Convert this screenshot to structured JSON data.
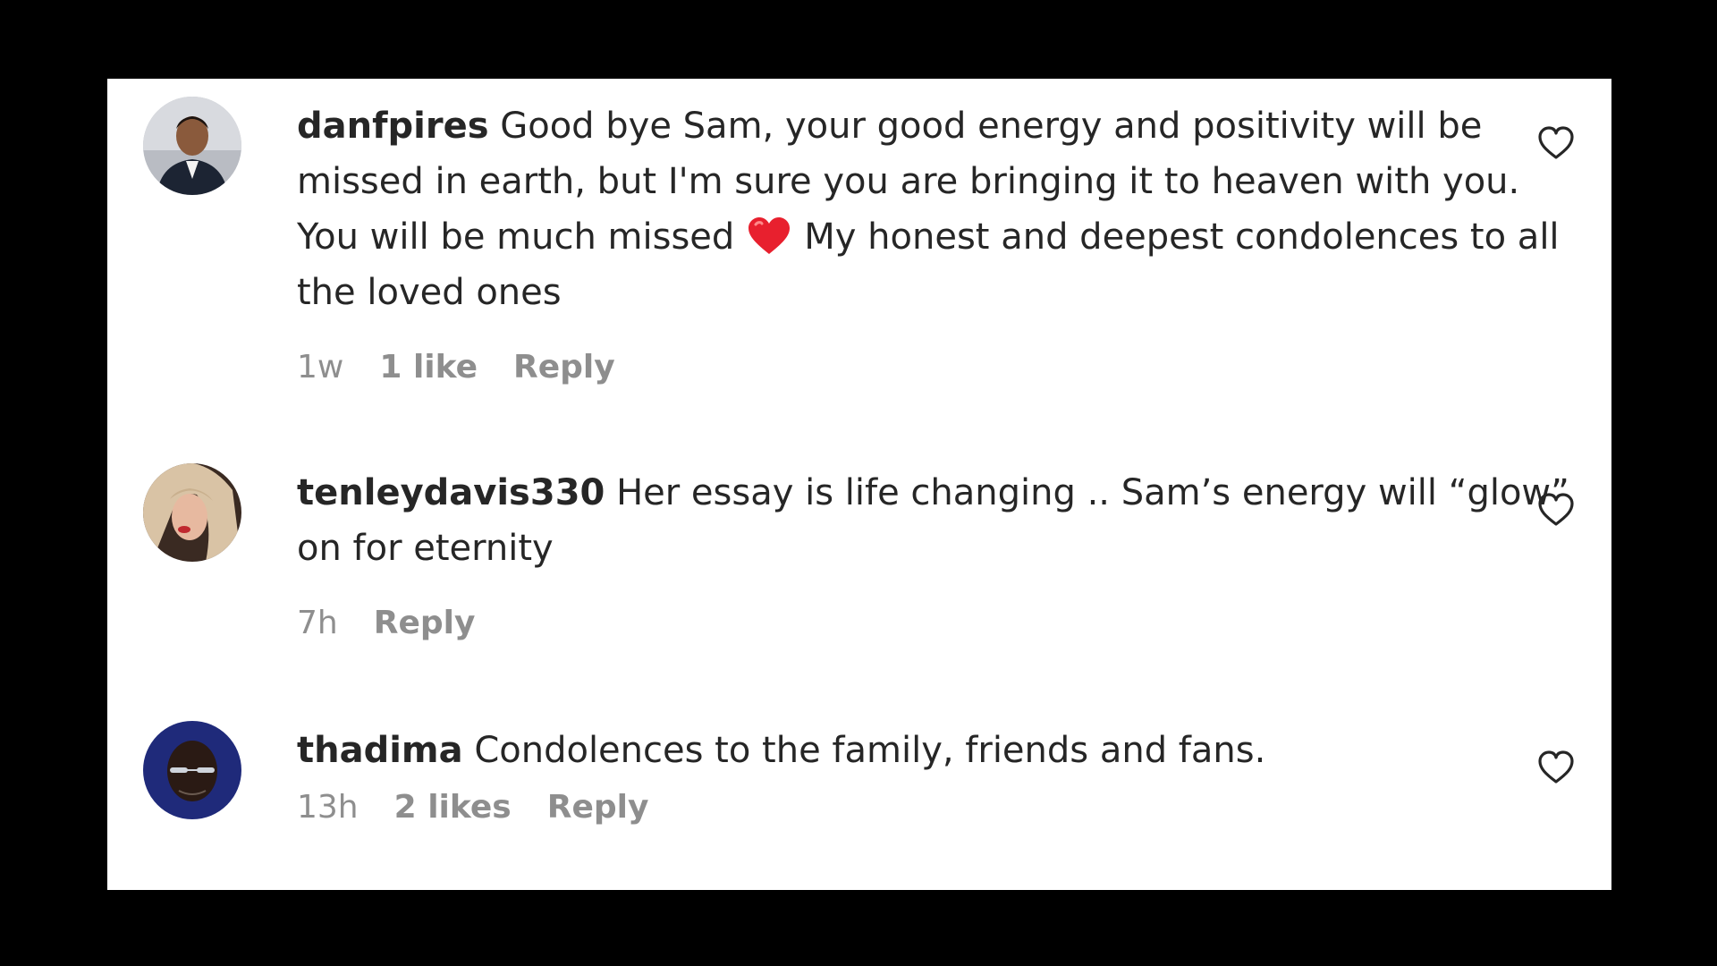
{
  "comments": [
    {
      "username": "danfpires",
      "text_before": "Good bye Sam, your good energy and positivity will be missed in earth, but I'm sure you are bringing it to heaven with you. You will be much missed",
      "emoji": "red-heart",
      "text_after": "My honest and deepest condolences to all the loved ones",
      "time": "1w",
      "likes": "1 like",
      "reply": "Reply"
    },
    {
      "username": "tenleydavis330",
      "text": "Her essay is life changing .. Sam’s energy will “glow” on for eternity",
      "time": "7h",
      "reply": "Reply"
    },
    {
      "username": "thadima",
      "text": "Condolences to the family, friends and fans.",
      "time": "13h",
      "likes": "2 likes",
      "reply": "Reply"
    }
  ],
  "colors": {
    "text": "#262626",
    "meta": "#8e8e8e",
    "heart_emoji": "#e8202e"
  },
  "icons": {
    "like": "heart-outline-icon",
    "emoji": "red-heart-emoji"
  }
}
